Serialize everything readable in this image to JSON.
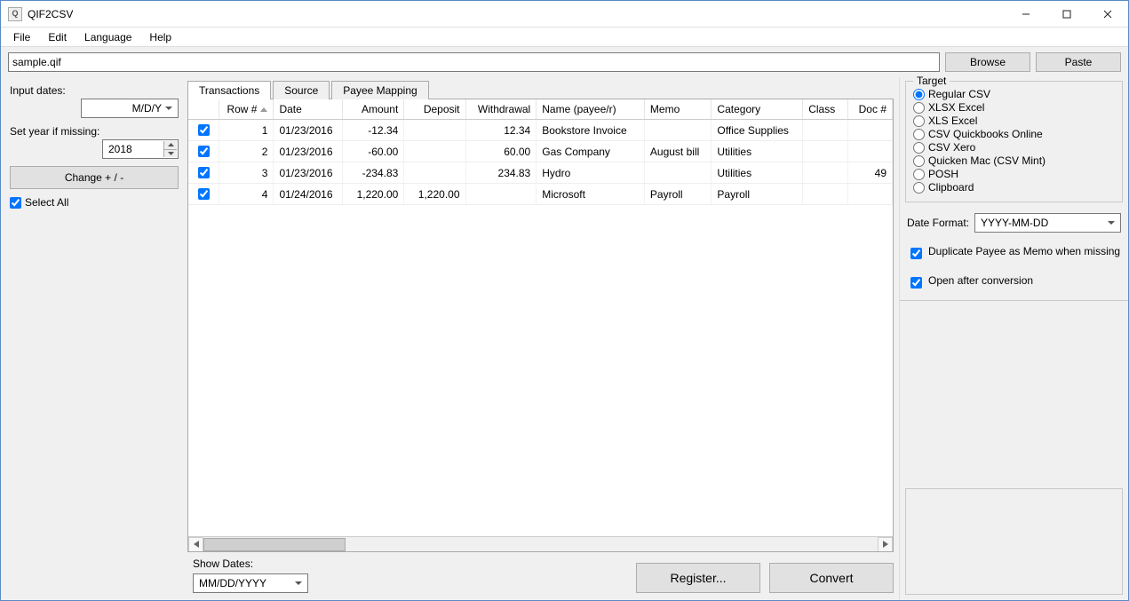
{
  "window": {
    "title": "QIF2CSV"
  },
  "menu": {
    "file": "File",
    "edit": "Edit",
    "language": "Language",
    "help": "Help"
  },
  "file": {
    "path": "sample.qif",
    "browse": "Browse",
    "paste": "Paste"
  },
  "left": {
    "input_dates_label": "Input dates:",
    "input_dates_value": "M/D/Y",
    "set_year_label": "Set year if missing:",
    "set_year_value": "2018",
    "change_btn": "Change + / -",
    "select_all": "Select All"
  },
  "tabs": {
    "transactions": "Transactions",
    "source": "Source",
    "payee": "Payee Mapping",
    "active": 0
  },
  "columns": [
    "",
    "Row #",
    "Date",
    "Amount",
    "Deposit",
    "Withdrawal",
    "Name (payee/r)",
    "Memo",
    "Category",
    "Class",
    "Doc #"
  ],
  "rows": [
    {
      "checked": true,
      "row": "1",
      "date": "01/23/2016",
      "amount": "-12.34",
      "deposit": "",
      "withdrawal": "12.34",
      "name": "Bookstore Invoice",
      "memo": "",
      "category": "Office Supplies",
      "class": "",
      "doc": ""
    },
    {
      "checked": true,
      "row": "2",
      "date": "01/23/2016",
      "amount": "-60.00",
      "deposit": "",
      "withdrawal": "60.00",
      "name": "Gas Company",
      "memo": "August bill",
      "category": "Utilities",
      "class": "",
      "doc": ""
    },
    {
      "checked": true,
      "row": "3",
      "date": "01/23/2016",
      "amount": "-234.83",
      "deposit": "",
      "withdrawal": "234.83",
      "name": "Hydro",
      "memo": "",
      "category": "Utilities",
      "class": "",
      "doc": "49"
    },
    {
      "checked": true,
      "row": "4",
      "date": "01/24/2016",
      "amount": "1,220.00",
      "deposit": "1,220.00",
      "withdrawal": "",
      "name": "Microsoft",
      "memo": "Payroll",
      "category": "Payroll",
      "class": "",
      "doc": ""
    }
  ],
  "bottom": {
    "show_dates_label": "Show Dates:",
    "show_dates_value": "MM/DD/YYYY",
    "register": "Register...",
    "convert": "Convert"
  },
  "right": {
    "target_legend": "Target",
    "options": [
      "Regular CSV",
      "XLSX Excel",
      "XLS Excel",
      "CSV Quickbooks Online",
      "CSV Xero",
      "Quicken Mac (CSV Mint)",
      "POSH",
      "Clipboard"
    ],
    "selected": 0,
    "date_format_label": "Date Format:",
    "date_format_value": "YYYY-MM-DD",
    "dup_payee": "Duplicate Payee as Memo when missing",
    "open_after": "Open after conversion"
  }
}
